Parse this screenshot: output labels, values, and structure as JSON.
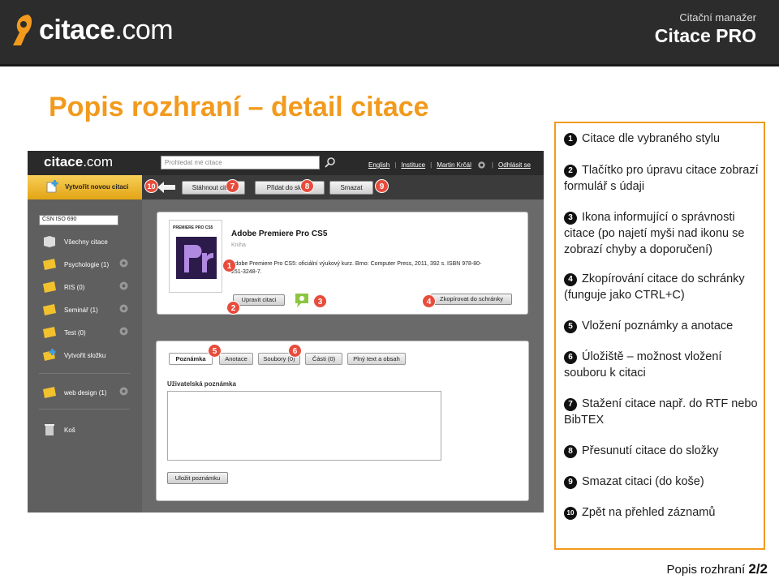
{
  "header": {
    "logo_text": "citace",
    "logo_suffix": ".com",
    "sub_title": "Citační manažer",
    "main_title": "Citace PRO"
  },
  "page_title": "Popis rozhraní – detail citace",
  "screenshot": {
    "logo_text": "citace",
    "logo_suffix": ".com",
    "search_placeholder": "Prohledat mé citace",
    "links": [
      "English",
      "Instituce",
      "Martin Krčál",
      "Odhlásit se"
    ],
    "new_citation": "Vytvořit novou citaci",
    "toolbar": {
      "download": "Stáhnout citaci",
      "move": "Přidat do složky",
      "delete": "Smazat"
    },
    "style_select": "ČSN ISO 690",
    "sidebar": [
      {
        "label": "Všechny citace"
      },
      {
        "label": "Psychologie (1)"
      },
      {
        "label": "RIS (0)"
      },
      {
        "label": "Seminář (1)"
      },
      {
        "label": "Test (0)"
      },
      {
        "label": "Vytvořit složku"
      },
      {
        "label": "web design (1)"
      },
      {
        "label": "Koš"
      }
    ],
    "citation": {
      "title": "Adobe Premiere Pro CS5",
      "kind": "Kniha",
      "text": "Adobe Premiere Pro CS5: oficiální výukový kurz. Brno: Computer Press, 2011, 392 s. ISBN 978-80-251-3248-7.",
      "edit_button": "Upravit citaci",
      "copy_button": "Zkopírovat do schránky",
      "book_cover_label": "PREMIERE PRO CS5"
    },
    "tabs": [
      "Poznámka",
      "Anotace",
      "Soubory (0)",
      "Části (0)",
      "Plný text a obsah"
    ],
    "note_label": "Uživatelská poznámka",
    "save_note": "Uložit poznámku",
    "markers": [
      "1",
      "2",
      "3",
      "4",
      "5",
      "6",
      "7",
      "8",
      "9",
      "10"
    ]
  },
  "legend": [
    {
      "num": "1",
      "text": "Citace dle vybraného stylu"
    },
    {
      "num": "2",
      "text": "Tlačítko pro úpravu citace zobrazí formulář s údaji"
    },
    {
      "num": "3",
      "text": "Ikona informující o správnosti citace (po najetí myši nad ikonu se zobrazí chyby a doporučení)"
    },
    {
      "num": "4",
      "text": "Zkopírování citace do schránky (funguje jako CTRL+C)"
    },
    {
      "num": "5",
      "text": "Vložení poznámky a anotace"
    },
    {
      "num": "6",
      "text": "Úložiště – možnost vložení souboru k citaci"
    },
    {
      "num": "7",
      "text": "Stažení citace např. do RTF nebo BibTEX"
    },
    {
      "num": "8",
      "text": "Přesunutí citace do složky"
    },
    {
      "num": "9",
      "text": "Smazat citaci (do koše)"
    },
    {
      "num": "10",
      "text": "Zpět na přehled záznamů"
    }
  ],
  "footer": {
    "label": "Popis rozhraní",
    "page": "2/2"
  },
  "colors": {
    "accent": "#f29a1d",
    "marker": "#e74c3c",
    "header_bg": "#2c2c2c"
  }
}
